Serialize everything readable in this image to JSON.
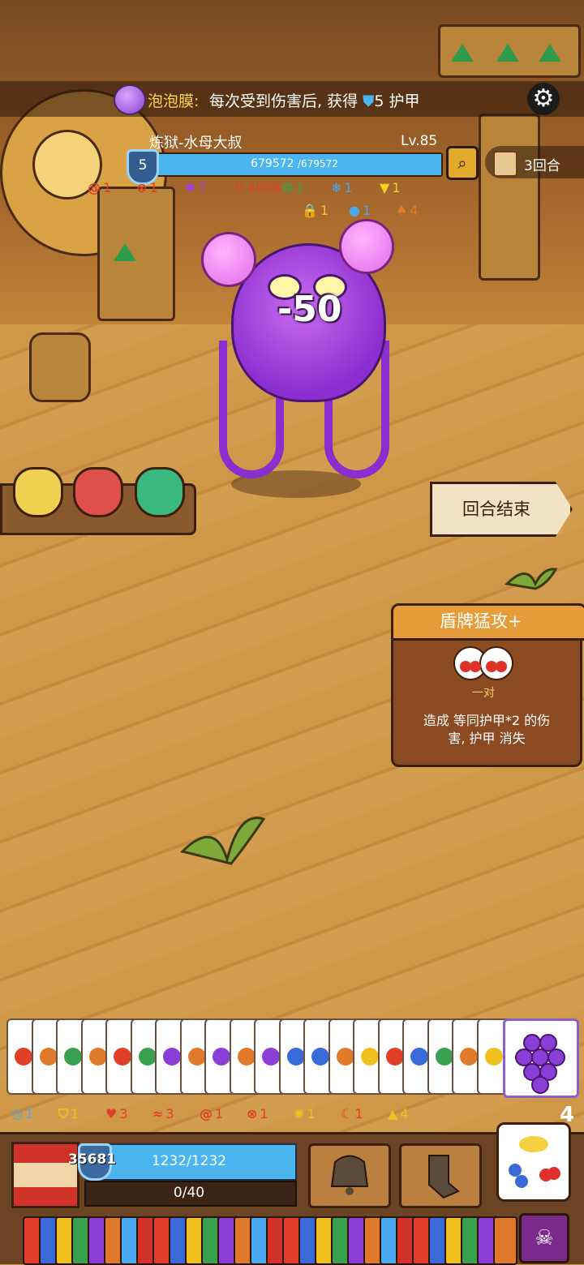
{
  "buff": {
    "name": "泡泡膜",
    "colon": ":",
    "desc": "每次受到伤害后, 获得",
    "amount": "5",
    "unit": "护甲"
  },
  "boss": {
    "name": "炼狱-水母大叔",
    "level": "Lv.85",
    "hp_current": 679572,
    "hp_max": 679572,
    "hp_text": "679572",
    "hp_max_text": "/679572",
    "shield": "5",
    "hp_color": "#4ab5ee"
  },
  "round": {
    "text": "3回合"
  },
  "boss_status_row1": [
    {
      "icon": "spiral-icon",
      "color": "#e0402a",
      "value": "1"
    },
    {
      "icon": "gear-x-icon",
      "color": "#e0402a",
      "value": "1"
    },
    {
      "icon": "splat-icon",
      "color": "#a040e0",
      "value": "7"
    },
    {
      "icon": "devil-icon",
      "color": "#e0402a",
      "value": "4008"
    },
    {
      "icon": "thorn-icon",
      "color": "#3aa050",
      "value": "1"
    },
    {
      "icon": "snowflake-icon",
      "color": "#4aa8f0",
      "value": "1"
    },
    {
      "icon": "yellow-rune-icon",
      "color": "#f0d020",
      "value": "1"
    }
  ],
  "boss_status_row2": [
    {
      "icon": "lock-icon",
      "color": "#f0c040",
      "value": "1"
    },
    {
      "icon": "speech-icon",
      "color": "#4aa8f0",
      "value": "1"
    },
    {
      "icon": "leaf-icon",
      "color": "#e07a2a",
      "value": "4"
    }
  ],
  "damage_popup": "-50",
  "end_turn": {
    "label": "回合结束"
  },
  "card_detail": {
    "title": "盾牌猛攻+",
    "combo": "一对",
    "desc_line1": "造成 等同护甲*2 的伤",
    "desc_line2": "害, 护甲 消失"
  },
  "hand": {
    "cards": [
      "#e0402a",
      "#e07a2a",
      "#3aa050",
      "#e07a2a",
      "#e0402a",
      "#3aa050",
      "#8b3ed6",
      "#e07a2a",
      "#8b3ed6",
      "#e07a2a",
      "#8b3ed6",
      "#3a6ad8",
      "#3a6ad8",
      "#e07a2a",
      "#f0c020",
      "#e0402a",
      "#3a6ad8",
      "#3aa050",
      "#e07a2a",
      "#f0c020"
    ],
    "selected": "grape-card"
  },
  "player_status": [
    {
      "icon": "swirl-icon",
      "color": "#4aa8f0",
      "value": "1"
    },
    {
      "icon": "shield-up-icon",
      "color": "#f0c020",
      "value": "1"
    },
    {
      "icon": "shield-heart-icon",
      "color": "#e0402a",
      "value": "3"
    },
    {
      "icon": "wave-icon",
      "color": "#e0402a",
      "value": "3"
    },
    {
      "icon": "spiral-icon",
      "color": "#e0402a",
      "value": "1"
    },
    {
      "icon": "gear-x-icon",
      "color": "#e0402a",
      "value": "1"
    },
    {
      "icon": "flame-icon",
      "color": "#f0c020",
      "value": "1"
    },
    {
      "icon": "crescent-icon",
      "color": "#e0402a",
      "value": "1"
    },
    {
      "icon": "arrow-up-icon",
      "color": "#f0c020",
      "value": "4"
    }
  ],
  "deck_count": "4",
  "player": {
    "shield": "35681",
    "hp_text": "1232/1232",
    "xp_text": "0/40",
    "hp_current": 1232,
    "hp_max": 1232
  }
}
